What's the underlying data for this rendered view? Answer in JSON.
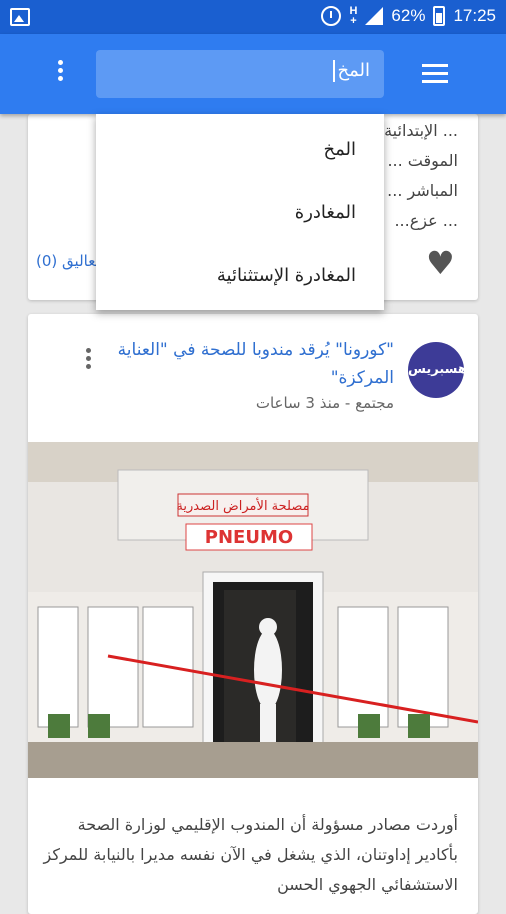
{
  "status_bar": {
    "battery": "62%",
    "time": "17:25"
  },
  "search": {
    "value": "المخ"
  },
  "suggestions": [
    "المخ",
    "المغادرة",
    "المغادرة الإستثنائية"
  ],
  "prev_card": {
    "snippet_lines": [
      "... الإبتدائية ...راج",
      "الموقت ...",
      "المباشر ... عن",
      "... عزع..."
    ],
    "comments": "تعاليق (0)"
  },
  "article": {
    "logo_text": "هسبريس",
    "title": "\"كورونا\" يُرقد مندوبا للصحة في \"العناية المركزة\"",
    "meta": "مجتمع - منذ 3 ساعات",
    "photo_signs": [
      "مصلحة الأمراض الصدرية",
      "PNEUMO"
    ],
    "body": "أوردت مصادر مسؤولة أن المندوب الإقليمي لوزارة الصحة بأكادير إداوتنان، الذي يشغل في الآن نفسه مديرا بالنيابة للمركز الاستشفائي الجهوي الحسن"
  }
}
